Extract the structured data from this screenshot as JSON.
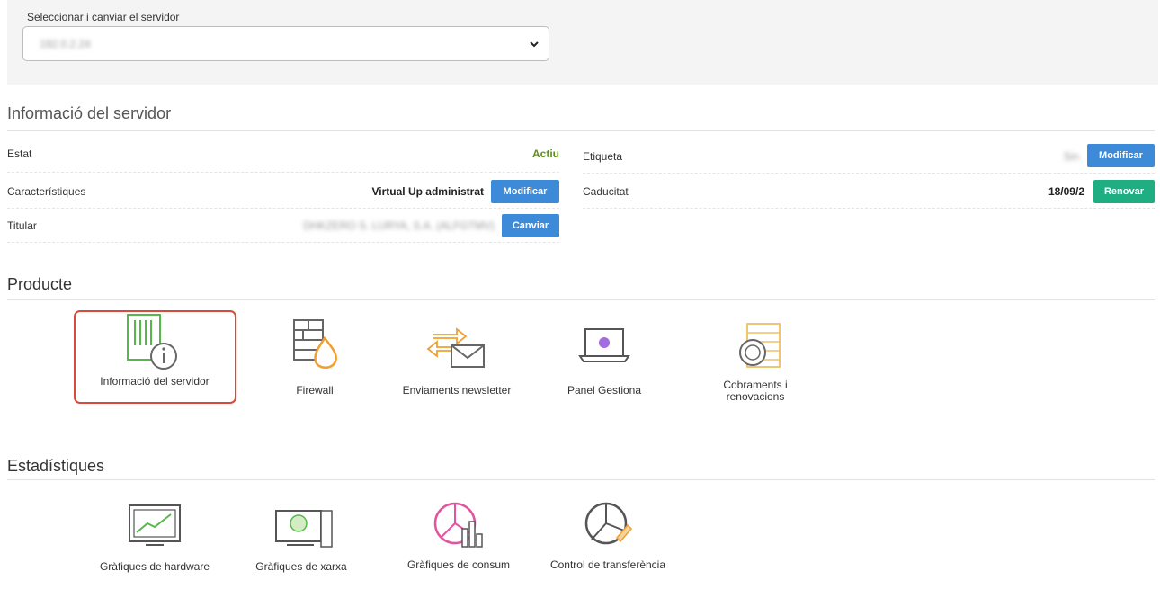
{
  "server_select": {
    "label": "Seleccionar i canviar el servidor",
    "selected_value": "192.0.2.24"
  },
  "server_info": {
    "title": "Informació del servidor",
    "rows_left": [
      {
        "label": "Estat",
        "value": "Actiu"
      },
      {
        "label": "Característiques",
        "value": "Virtual Up administrat",
        "button": "Modificar"
      },
      {
        "label": "Titular",
        "value": "DHKZERO S. LURYA, S.A. (ALFGTMV)",
        "button": "Canviar"
      }
    ],
    "rows_right": [
      {
        "label": "Etiqueta",
        "value": "Sin",
        "button": "Modificar"
      },
      {
        "label": "Caducitat",
        "value": "18/09/2",
        "button": "Renovar"
      }
    ]
  },
  "product": {
    "title": "Producte",
    "items": [
      {
        "label": "Informació del servidor",
        "icon": "server-info-icon"
      },
      {
        "label": "Firewall",
        "icon": "firewall-icon"
      },
      {
        "label": "Enviaments newsletter",
        "icon": "newsletter-icon"
      },
      {
        "label": "Panel Gestiona",
        "icon": "panel-icon"
      },
      {
        "label": "Cobraments i renovacions",
        "icon": "payments-icon"
      }
    ]
  },
  "stats": {
    "title": "Estadístiques",
    "items": [
      {
        "label": "Gràfiques de hardware",
        "icon": "hardware-chart-icon"
      },
      {
        "label": "Gràfiques de xarxa",
        "icon": "network-chart-icon"
      },
      {
        "label": "Gràfiques de consum",
        "icon": "consumption-chart-icon"
      },
      {
        "label": "Control de transferència",
        "icon": "transfer-control-icon"
      }
    ]
  },
  "colors": {
    "accent_blue": "#3d8ad8",
    "accent_green": "#1fae82",
    "status_green": "#5f8f1f",
    "selected_outline": "#d84a3a"
  }
}
